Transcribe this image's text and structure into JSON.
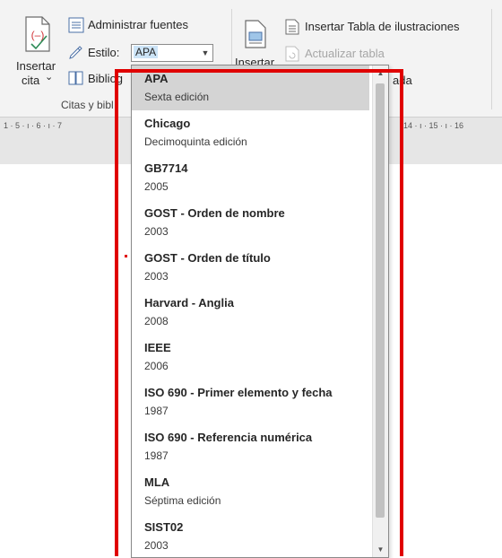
{
  "ribbon": {
    "insert_citation_label_1": "Insertar",
    "insert_citation_label_2": "cita",
    "insert_citation_chevron": "⌄",
    "manage_sources": "Administrar fuentes",
    "style_label": "Estilo:",
    "style_value": "APA",
    "bibliography": "Bibliog",
    "group_label": "Citas y bibl",
    "insert_caption_label": "Insertar",
    "insert_table_of_figures": "Insertar Tabla de ilustraciones",
    "update_table": "Actualizar tabla",
    "cross_reference_partial": "ada",
    "icons": [
      "insert-citation-icon",
      "manage-sources-icon",
      "style-icon",
      "bibliography-icon",
      "insert-caption-icon",
      "table-of-figures-icon",
      "update-table-icon"
    ]
  },
  "ruler": {
    "left": "1 · 5 · ı · 6 · ı · 7",
    "right": "14 · ı · 15 · ı · 16"
  },
  "dropdown": {
    "items": [
      {
        "name": "APA",
        "sub": "Sexta edición",
        "selected": true
      },
      {
        "name": "Chicago",
        "sub": "Decimoquinta edición"
      },
      {
        "name": "GB7714",
        "sub": "2005"
      },
      {
        "name": "GOST - Orden de nombre",
        "sub": "2003"
      },
      {
        "name": "GOST - Orden de título",
        "sub": "2003"
      },
      {
        "name": "Harvard - Anglia",
        "sub": "2008"
      },
      {
        "name": "IEEE",
        "sub": "2006"
      },
      {
        "name": "ISO 690 - Primer elemento y fecha",
        "sub": "1987"
      },
      {
        "name": "ISO 690 - Referencia numérica",
        "sub": "1987"
      },
      {
        "name": "MLA",
        "sub": "Séptima edición"
      },
      {
        "name": "SIST02",
        "sub": "2003"
      }
    ]
  },
  "colors": {
    "highlight": "#e00000",
    "selected": "#d4d4d4",
    "accent": "#2b7cd3"
  }
}
